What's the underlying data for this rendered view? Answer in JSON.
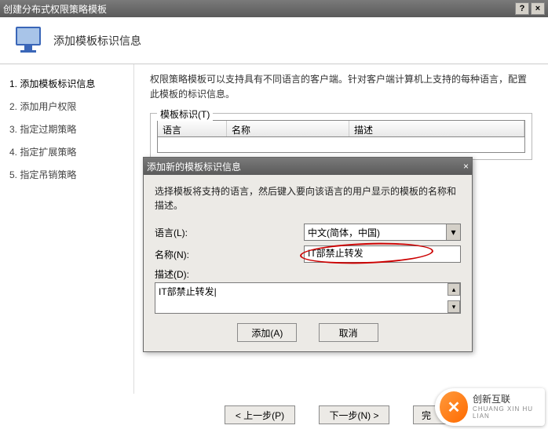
{
  "window": {
    "title": "创建分布式权限策略模板",
    "help": "?",
    "close": "×"
  },
  "header": {
    "title": "添加模板标识信息"
  },
  "sidebar": {
    "items": [
      {
        "num": "1.",
        "label": "添加模板标识信息"
      },
      {
        "num": "2.",
        "label": "添加用户权限"
      },
      {
        "num": "3.",
        "label": "指定过期策略"
      },
      {
        "num": "4.",
        "label": "指定扩展策略"
      },
      {
        "num": "5.",
        "label": "指定吊销策略"
      }
    ]
  },
  "content": {
    "description": "权限策略模板可以支持具有不同语言的客户端。针对客户端计算机上支持的每种语言，配置此模板的标识信息。",
    "fieldset_label": "模板标识(T)",
    "columns": {
      "lang": "语言",
      "name": "名称",
      "desc": "描述"
    }
  },
  "dialog": {
    "title": "添加新的模板标识信息",
    "close": "×",
    "description": "选择模板将支持的语言，然后键入要向该语言的用户显示的模板的名称和描述。",
    "lang_label": "语言(L):",
    "lang_value": "中文(简体，中国)",
    "name_label": "名称(N):",
    "name_value": "IT部禁止转发",
    "desc_label": "描述(D):",
    "desc_value": "IT部禁止转发|",
    "btn_add": "添加(A)",
    "btn_cancel": "取消"
  },
  "wizard": {
    "prev": "< 上一步(P)",
    "next": "下一步(N) >",
    "finish": "完"
  },
  "logo": {
    "brand": "创新互联",
    "sub": "CHUANG XIN HU LIAN"
  }
}
